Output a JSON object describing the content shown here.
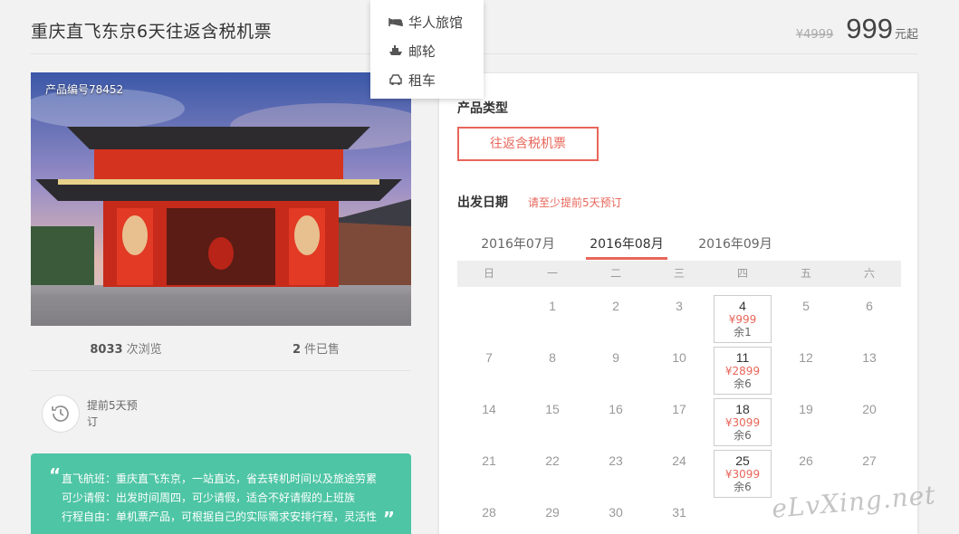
{
  "header": {
    "title": "重庆直飞东京6天往返含税机票",
    "old_price": "¥4999",
    "price": "999",
    "price_unit": "元起"
  },
  "dropdown": {
    "items": [
      {
        "label": "华人旅馆",
        "icon": "hotel-icon"
      },
      {
        "label": "邮轮",
        "icon": "ship-icon"
      },
      {
        "label": "租车",
        "icon": "car-icon"
      }
    ]
  },
  "product": {
    "product_no": "产品编号78452",
    "views_count": "8033",
    "views_label": "次浏览",
    "sold_count": "2",
    "sold_label": "件已售",
    "advance_text": "提前5天预订"
  },
  "description": {
    "line1": "直飞航班：重庆直飞东京，一站直达，省去转机时间以及旅途劳累",
    "line2": "可少请假：出发时间周四，可少请假，适合不好请假的上班族",
    "line3": "行程自由：单机票产品，可根据自己的实际需求安排行程，灵活性"
  },
  "booking": {
    "type_label": "产品类型",
    "type_option": "往返含税机票",
    "date_label": "出发日期",
    "date_hint": "请至少提前5天预订",
    "months": [
      "2016年07月",
      "2016年08月",
      "2016年09月"
    ],
    "active_month": "2016年08月",
    "weekdays": [
      "日",
      "一",
      "二",
      "三",
      "四",
      "五",
      "六"
    ],
    "calendar": [
      [
        {
          "d": ""
        },
        {
          "d": "1"
        },
        {
          "d": "2"
        },
        {
          "d": "3"
        },
        {
          "d": "4",
          "price": "¥999",
          "remain": "余1"
        },
        {
          "d": "5"
        },
        {
          "d": "6"
        }
      ],
      [
        {
          "d": "7"
        },
        {
          "d": "8"
        },
        {
          "d": "9"
        },
        {
          "d": "10"
        },
        {
          "d": "11",
          "price": "¥2899",
          "remain": "余6"
        },
        {
          "d": "12"
        },
        {
          "d": "13"
        }
      ],
      [
        {
          "d": "14"
        },
        {
          "d": "15"
        },
        {
          "d": "16"
        },
        {
          "d": "17"
        },
        {
          "d": "18",
          "price": "¥3099",
          "remain": "余6"
        },
        {
          "d": "19"
        },
        {
          "d": "20"
        }
      ],
      [
        {
          "d": "21"
        },
        {
          "d": "22"
        },
        {
          "d": "23"
        },
        {
          "d": "24"
        },
        {
          "d": "25",
          "price": "¥3099",
          "remain": "余6"
        },
        {
          "d": "26"
        },
        {
          "d": "27"
        }
      ],
      [
        {
          "d": "28"
        },
        {
          "d": "29"
        },
        {
          "d": "30"
        },
        {
          "d": "31"
        },
        {
          "d": ""
        },
        {
          "d": ""
        },
        {
          "d": ""
        }
      ]
    ]
  },
  "watermark": "eLvXing.net",
  "colors": {
    "accent": "#e8665a",
    "desc_bg": "#4ec5a5"
  }
}
